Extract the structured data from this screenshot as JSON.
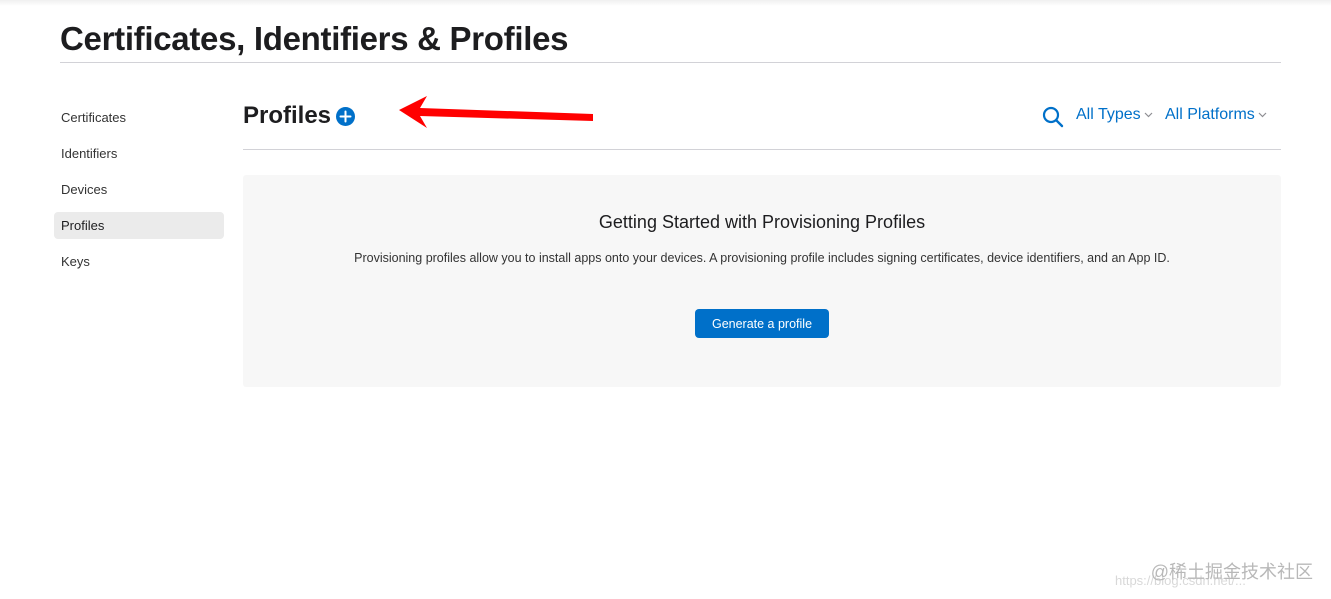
{
  "page": {
    "title": "Certificates, Identifiers & Profiles"
  },
  "sidebar": {
    "items": [
      {
        "label": "Certificates",
        "active": false
      },
      {
        "label": "Identifiers",
        "active": false
      },
      {
        "label": "Devices",
        "active": false
      },
      {
        "label": "Profiles",
        "active": true
      },
      {
        "label": "Keys",
        "active": false
      }
    ]
  },
  "section": {
    "title": "Profiles",
    "add_icon": "plus-circle-icon",
    "search_icon": "search-icon",
    "filters": {
      "types": "All Types",
      "platforms": "All Platforms"
    }
  },
  "empty_state": {
    "heading": "Getting Started with Provisioning Profiles",
    "body": "Provisioning profiles allow you to install apps onto your devices. A provisioning profile includes signing certificates, device identifiers, and an App ID.",
    "button_label": "Generate a profile"
  },
  "annotation": {
    "icon": "red-arrow-icon",
    "color": "#ff0000"
  },
  "watermark": {
    "text": "@稀土掘金技术社区",
    "url": "https://blog.csdn.net/..."
  },
  "colors": {
    "accent": "#0070c9",
    "text": "#1d1d1f",
    "panel": "#f7f7f7"
  }
}
